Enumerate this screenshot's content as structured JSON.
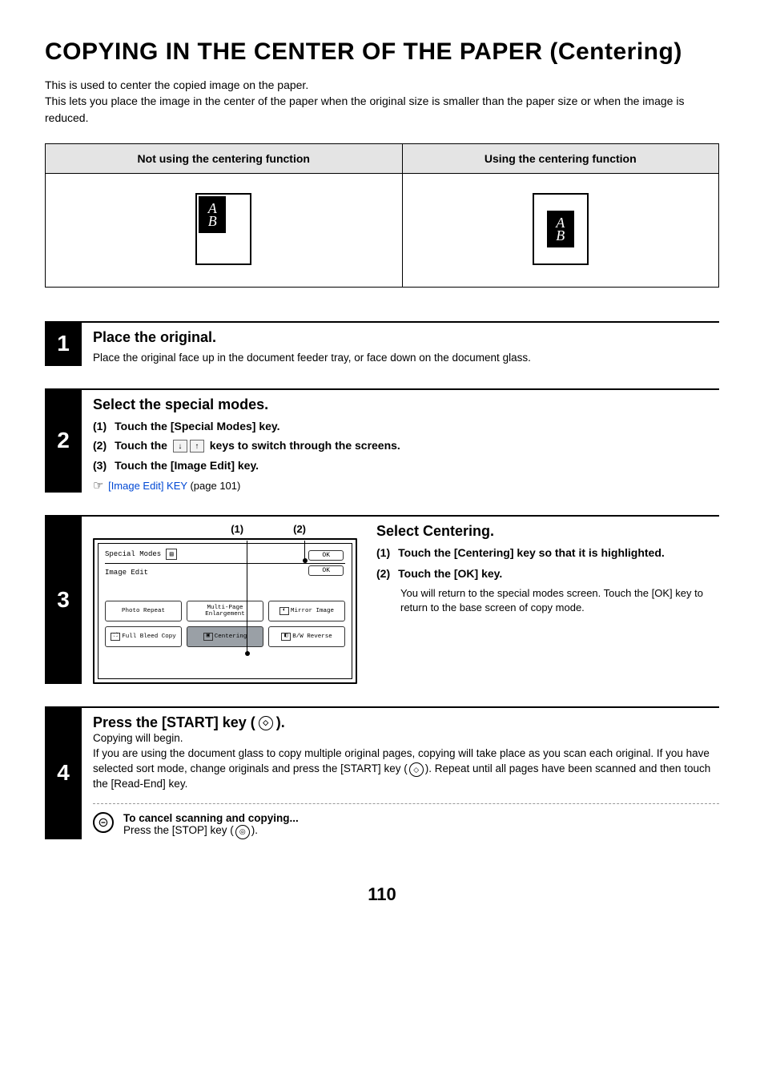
{
  "title": "COPYING IN THE CENTER OF THE PAPER (Centering)",
  "intro": {
    "p1": "This is used to center the copied image on the paper.",
    "p2": "This lets you place the image in the center of the paper when the original size is smaller than the paper size or when the image is reduced."
  },
  "compare": {
    "left_header": "Not using the centering function",
    "right_header": "Using the centering function",
    "ab_a": "A",
    "ab_b": "B"
  },
  "step1": {
    "num": "1",
    "title": "Place the original.",
    "text": "Place the original face up in the document feeder tray, or face down on the document glass."
  },
  "step2": {
    "num": "2",
    "title": "Select the special modes.",
    "items": {
      "n1": "(1)",
      "l1": "Touch the [Special Modes] key.",
      "n2": "(2)",
      "l2a": "Touch the ",
      "l2b": " keys to switch through the screens.",
      "n3": "(3)",
      "l3": "Touch the [Image Edit] key."
    },
    "ref": {
      "link": "[Image Edit] KEY",
      "suffix": " (page 101)"
    }
  },
  "step3": {
    "num": "3",
    "callouts": {
      "c1": "(1)",
      "c2": "(2)"
    },
    "screen": {
      "header": "Special Modes",
      "subtitle": "Image Edit",
      "ok": "OK",
      "buttons": {
        "b1": "Photo Repeat",
        "b2": "Multi-Page Enlargement",
        "b3": "Mirror Image",
        "b4": "Full Bleed Copy",
        "b5": "Centering",
        "b6": "B/W Reverse"
      }
    },
    "right": {
      "title": "Select Centering.",
      "i1n": "(1)",
      "i1l": "Touch the [Centering] key so that it is highlighted.",
      "i2n": "(2)",
      "i2l": "Touch the [OK] key.",
      "i2d": "You will return to the special modes screen. Touch the [OK] key to return to the base screen of copy mode."
    }
  },
  "step4": {
    "num": "4",
    "title_a": "Press the [START] key (",
    "title_b": ").",
    "p1": "Copying will begin.",
    "p2a": "If you are using the document glass to copy multiple original pages, copying will take place as you scan each original. If you have selected sort mode, change originals and press the [START] key (",
    "p2b": "). Repeat until all pages have been scanned and then touch the [Read-End] key.",
    "cancel_title": "To cancel scanning and copying...",
    "cancel_a": "Press the [STOP] key (",
    "cancel_b": ")."
  },
  "page_number": "110"
}
